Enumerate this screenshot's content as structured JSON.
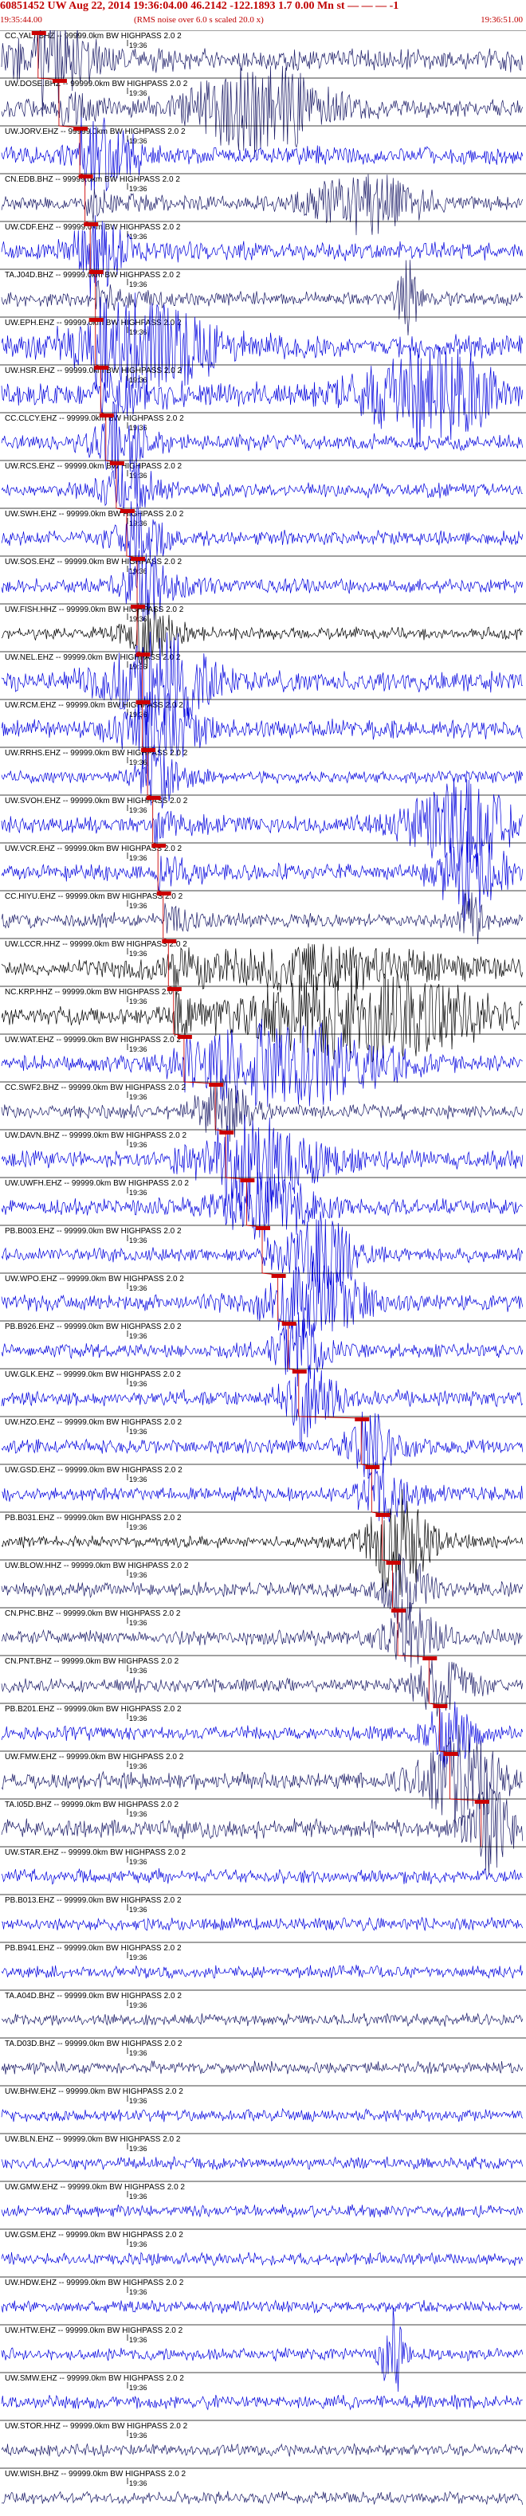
{
  "header": {
    "title": "60851452 UW Aug 22, 2014 19:36:04.00    46.2142 -122.1893  1.7 0.00 Mn st — — —  -1",
    "start_time": "19:35:44.00",
    "rms_note": "(RMS noise over 6.0 s scaled 20.0 x)",
    "end_time": "19:36:51.00"
  },
  "colors": {
    "header": "#c00000",
    "pick": "#cc0000",
    "trace_blue": "#0000dd",
    "trace_black": "#000000",
    "trace_navy": "#1a1a66"
  },
  "chart_data": {
    "type": "line",
    "title": "60851452 UW Aug 22, 2014 19:36:04.00 46.2142 -122.1893 1.7 0.00 Mn",
    "xlim": [
      "19:35:44.00",
      "19:36:51.00"
    ],
    "tick_label": "19:36",
    "channel_label_suffix": "-- 99999.0km BW  HIGHPASS  2.0  2",
    "grid": false,
    "series": [
      {
        "name": "CC.YALT.BHZ",
        "color": "#1a1a66",
        "pick": 0.07,
        "amp": 0.55,
        "burst": [
          0.1,
          0.08,
          1.0
        ]
      },
      {
        "name": "UW.DOSE.BHZ",
        "color": "#1a1a66",
        "pick": 0.11,
        "amp": 0.45,
        "burst": [
          0.5,
          0.12,
          1.9
        ]
      },
      {
        "name": "UW.JORV.EHZ",
        "color": "#0000dd",
        "pick": 0.15,
        "amp": 0.45,
        "burst": [
          0.2,
          0.06,
          1.0
        ]
      },
      {
        "name": "CN.EDB.BHZ",
        "color": "#1a1a66",
        "pick": 0.16,
        "amp": 0.35,
        "burst": [
          0.7,
          0.1,
          1.2
        ]
      },
      {
        "name": "UW.CDF.EHZ",
        "color": "#0000dd",
        "pick": 0.17,
        "amp": 0.45,
        "burst": [
          0.18,
          0.05,
          1.0
        ]
      },
      {
        "name": "TA.J04D.BHZ",
        "color": "#1a1a66",
        "pick": 0.18,
        "amp": 0.35,
        "burst": [
          0.78,
          0.02,
          1.5
        ]
      },
      {
        "name": "UW.EPH.EHZ",
        "color": "#0000dd",
        "pick": 0.18,
        "amp": 0.55,
        "burst": [
          0.28,
          0.14,
          1.6
        ]
      },
      {
        "name": "UW.HSR.EHZ",
        "color": "#0000dd",
        "pick": 0.19,
        "amp": 0.6,
        "burst": [
          0.82,
          0.12,
          1.8
        ]
      },
      {
        "name": "CC.CLCY.EHZ",
        "color": "#0000dd",
        "pick": 0.2,
        "amp": 0.4,
        "burst": [
          0.22,
          0.05,
          1.0
        ]
      },
      {
        "name": "UW.RCS.EHZ",
        "color": "#0000dd",
        "pick": 0.22,
        "amp": 0.35,
        "burst": [
          0.24,
          0.05,
          0.9
        ]
      },
      {
        "name": "UW.SWH.EHZ",
        "color": "#0000dd",
        "pick": 0.24,
        "amp": 0.35,
        "burst": [
          0.26,
          0.05,
          0.9
        ]
      },
      {
        "name": "UW.SOS.EHZ",
        "color": "#0000dd",
        "pick": 0.26,
        "amp": 0.35,
        "burst": [
          0.28,
          0.05,
          0.9
        ]
      },
      {
        "name": "UW.FISH.HHZ",
        "color": "#000000",
        "pick": 0.26,
        "amp": 0.3,
        "burst": [
          0.28,
          0.05,
          0.9
        ]
      },
      {
        "name": "UW.NEL.EHZ",
        "color": "#0000dd",
        "pick": 0.27,
        "amp": 0.5,
        "burst": [
          0.3,
          0.1,
          1.5
        ]
      },
      {
        "name": "UW.RCM.EHZ",
        "color": "#0000dd",
        "pick": 0.27,
        "amp": 0.45,
        "burst": [
          0.3,
          0.08,
          1.0
        ]
      },
      {
        "name": "UW.RRHS.EHZ",
        "color": "#0000dd",
        "pick": 0.28,
        "amp": 0.3,
        "burst": [
          0.3,
          0.05,
          0.8
        ]
      },
      {
        "name": "UW.SVOH.EHZ",
        "color": "#0000dd",
        "pick": 0.29,
        "amp": 0.4,
        "burst": [
          0.88,
          0.1,
          1.7
        ]
      },
      {
        "name": "UW.VCR.EHZ",
        "color": "#0000dd",
        "pick": 0.3,
        "amp": 0.4,
        "burst": [
          0.9,
          0.06,
          1.8
        ]
      },
      {
        "name": "CC.HIYU.EHZ",
        "color": "#1a1a66",
        "pick": 0.31,
        "amp": 0.35,
        "burst": [
          0.9,
          0.02,
          1.2
        ]
      },
      {
        "name": "UW.LCCR.HHZ",
        "color": "#000000",
        "pick": 0.32,
        "amp": 0.3,
        "burst": [
          0.6,
          0.3,
          0.8
        ]
      },
      {
        "name": "NC.KRP.HHZ",
        "color": "#000000",
        "pick": 0.33,
        "amp": 0.45,
        "burst": [
          0.7,
          0.22,
          1.8
        ]
      },
      {
        "name": "UW.WAT.EHZ",
        "color": "#0000dd",
        "pick": 0.35,
        "amp": 0.4,
        "burst": [
          0.55,
          0.18,
          1.7
        ]
      },
      {
        "name": "CC.SWF2.BHZ",
        "color": "#1a1a66",
        "pick": 0.41,
        "amp": 0.35,
        "burst": [
          0.42,
          0.05,
          0.9
        ]
      },
      {
        "name": "UW.DAVN.BHZ",
        "color": "#0000dd",
        "pick": 0.43,
        "amp": 0.45,
        "burst": [
          0.5,
          0.12,
          1.5
        ]
      },
      {
        "name": "UW.UWFH.EHZ",
        "color": "#0000dd",
        "pick": 0.47,
        "amp": 0.4,
        "burst": [
          0.5,
          0.1,
          1.0
        ]
      },
      {
        "name": "PB.B003.EHZ",
        "color": "#0000dd",
        "pick": 0.5,
        "amp": 0.35,
        "burst": [
          0.62,
          0.06,
          1.5
        ]
      },
      {
        "name": "UW.WPO.EHZ",
        "color": "#0000dd",
        "pick": 0.53,
        "amp": 0.4,
        "burst": [
          0.6,
          0.1,
          1.4
        ]
      },
      {
        "name": "PB.B926.EHZ",
        "color": "#0000dd",
        "pick": 0.55,
        "amp": 0.35,
        "burst": [
          0.57,
          0.05,
          1.0
        ]
      },
      {
        "name": "UW.GLK.EHZ",
        "color": "#0000dd",
        "pick": 0.57,
        "amp": 0.4,
        "burst": [
          0.59,
          0.05,
          1.2
        ]
      },
      {
        "name": "UW.HZO.EHZ",
        "color": "#0000dd",
        "pick": 0.69,
        "amp": 0.35,
        "burst": [
          0.71,
          0.05,
          0.9
        ]
      },
      {
        "name": "UW.GSD.EHZ",
        "color": "#0000dd",
        "pick": 0.71,
        "amp": 0.35,
        "burst": [
          0.73,
          0.05,
          0.9
        ]
      },
      {
        "name": "PB.B031.EHZ",
        "color": "#000000",
        "pick": 0.73,
        "amp": 0.3,
        "burst": [
          0.76,
          0.06,
          1.8
        ]
      },
      {
        "name": "UW.BLOW.HHZ",
        "color": "#1a1a66",
        "pick": 0.75,
        "amp": 0.35,
        "burst": [
          0.77,
          0.05,
          0.9
        ]
      },
      {
        "name": "CN.PHC.BHZ",
        "color": "#1a1a66",
        "pick": 0.76,
        "amp": 0.35,
        "burst": [
          0.78,
          0.05,
          1.0
        ]
      },
      {
        "name": "CN.PNT.BHZ",
        "color": "#1a1a66",
        "pick": 0.82,
        "amp": 0.35,
        "burst": [
          0.84,
          0.05,
          1.0
        ]
      },
      {
        "name": "PB.B201.EHZ",
        "color": "#0000dd",
        "pick": 0.84,
        "amp": 0.35,
        "burst": [
          0.86,
          0.05,
          1.0
        ]
      },
      {
        "name": "UW.FMW.EHZ",
        "color": "#1a1a66",
        "pick": 0.86,
        "amp": 0.4,
        "burst": [
          0.88,
          0.08,
          1.6
        ]
      },
      {
        "name": "TA.I05D.BHZ",
        "color": "#1a1a66",
        "pick": 0.92,
        "amp": 0.45,
        "burst": [
          0.93,
          0.04,
          1.4
        ]
      },
      {
        "name": "UW.STAR.EHZ",
        "color": "#0000dd",
        "pick": null,
        "amp": 0.35,
        "burst": null
      },
      {
        "name": "PB.B013.EHZ",
        "color": "#0000dd",
        "pick": null,
        "amp": 0.3,
        "burst": null
      },
      {
        "name": "PB.B941.EHZ",
        "color": "#0000dd",
        "pick": null,
        "amp": 0.3,
        "burst": null
      },
      {
        "name": "TA.A04D.BHZ",
        "color": "#1a1a66",
        "pick": null,
        "amp": 0.3,
        "burst": null
      },
      {
        "name": "TA.D03D.BHZ",
        "color": "#1a1a66",
        "pick": null,
        "amp": 0.3,
        "burst": null
      },
      {
        "name": "UW.BHW.EHZ",
        "color": "#0000dd",
        "pick": null,
        "amp": 0.3,
        "burst": null
      },
      {
        "name": "UW.BLN.EHZ",
        "color": "#0000dd",
        "pick": null,
        "amp": 0.3,
        "burst": null
      },
      {
        "name": "UW.GMW.EHZ",
        "color": "#0000dd",
        "pick": null,
        "amp": 0.3,
        "burst": null
      },
      {
        "name": "UW.GSM.EHZ",
        "color": "#0000dd",
        "pick": null,
        "amp": 0.3,
        "burst": null
      },
      {
        "name": "UW.HDW.EHZ",
        "color": "#0000dd",
        "pick": null,
        "amp": 0.3,
        "burst": null
      },
      {
        "name": "UW.HTW.EHZ",
        "color": "#0000dd",
        "pick": null,
        "amp": 0.3,
        "burst": [
          0.75,
          0.02,
          1.9
        ]
      },
      {
        "name": "UW.SMW.EHZ",
        "color": "#0000dd",
        "pick": null,
        "amp": 0.35,
        "burst": null
      },
      {
        "name": "UW.STOR.HHZ",
        "color": "#1a1a66",
        "pick": null,
        "amp": 0.3,
        "burst": null
      },
      {
        "name": "UW.WISH.BHZ",
        "color": "#1a1a66",
        "pick": null,
        "amp": 0.3,
        "burst": null
      }
    ]
  }
}
